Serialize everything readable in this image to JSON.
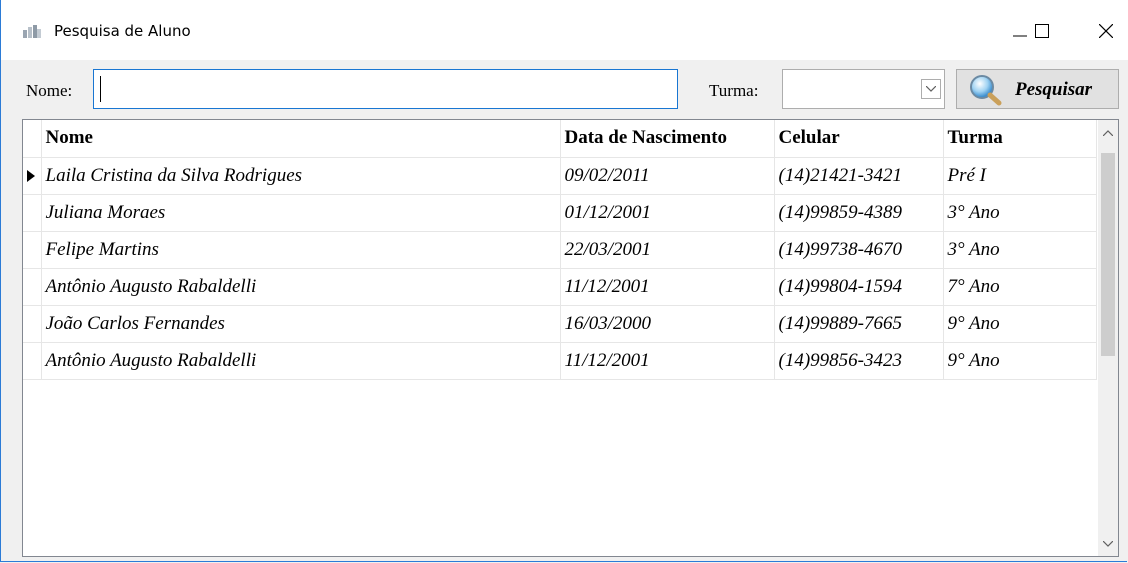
{
  "window": {
    "title": "Pesquisa de Aluno"
  },
  "search": {
    "nome_label": "Nome:",
    "nome_value": "",
    "turma_label": "Turma:",
    "turma_value": "",
    "search_button_label": "Pesquisar"
  },
  "grid": {
    "columns": [
      "Nome",
      "Data de Nascimento",
      "Celular",
      "Turma"
    ],
    "rows": [
      {
        "nome": "Laila Cristina da Silva Rodrigues",
        "data": "09/02/2011",
        "celular": "(14)21421-3421",
        "turma": "Pré I"
      },
      {
        "nome": "Juliana Moraes",
        "data": "01/12/2001",
        "celular": "(14)99859-4389",
        "turma": "3° Ano"
      },
      {
        "nome": "Felipe Martins",
        "data": "22/03/2001",
        "celular": "(14)99738-4670",
        "turma": "3° Ano"
      },
      {
        "nome": "Antônio Augusto Rabaldelli",
        "data": "11/12/2001",
        "celular": "(14)99804-1594",
        "turma": "7° Ano"
      },
      {
        "nome": "João Carlos Fernandes",
        "data": "16/03/2000",
        "celular": "(14)99889-7665",
        "turma": "9° Ano"
      },
      {
        "nome": "Antônio Augusto Rabaldelli",
        "data": "11/12/2001",
        "celular": "(14)99856-3423",
        "turma": "9° Ano"
      }
    ],
    "selected_row": 0
  },
  "icons": {
    "app": "app-icon",
    "minimize": "minimize-icon",
    "maximize": "maximize-icon",
    "close": "close-icon",
    "dropdown": "chevron-down-icon",
    "search": "magnifier-icon",
    "row_indicator": "current-row-arrow-icon"
  },
  "colors": {
    "accent_border": "#1976d2",
    "window_bg": "#f0f0f0"
  }
}
